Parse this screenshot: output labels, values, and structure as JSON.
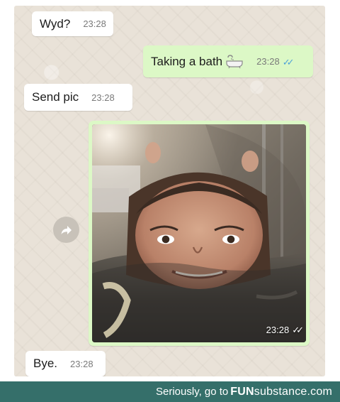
{
  "chat": {
    "background_color": "#e9e2d8",
    "messages": [
      {
        "text": "Wyd?",
        "time": "23:28",
        "direction": "incoming"
      },
      {
        "text": "Taking a bath",
        "icon": "bathtub-emoji",
        "time": "23:28",
        "direction": "outgoing",
        "read": true
      },
      {
        "text": "Send pic",
        "time": "23:28",
        "direction": "incoming"
      },
      {
        "image": "bath-selfie-photo",
        "time": "23:28",
        "direction": "outgoing",
        "read": true
      },
      {
        "text": "Bye.",
        "time": "23:28",
        "direction": "incoming"
      }
    ],
    "forward_icon": "share-arrow-icon",
    "colors": {
      "incoming_bubble": "#ffffff",
      "outgoing_bubble": "#dcf8c6",
      "timestamp": "#7a7a7a",
      "read_ticks": "#4fa3d8"
    }
  },
  "footer": {
    "prefix": "Seriously, go to",
    "brand_fun": "FUN",
    "brand_rest": "substance",
    "brand_domain": ".com",
    "background": "#356f6a"
  }
}
